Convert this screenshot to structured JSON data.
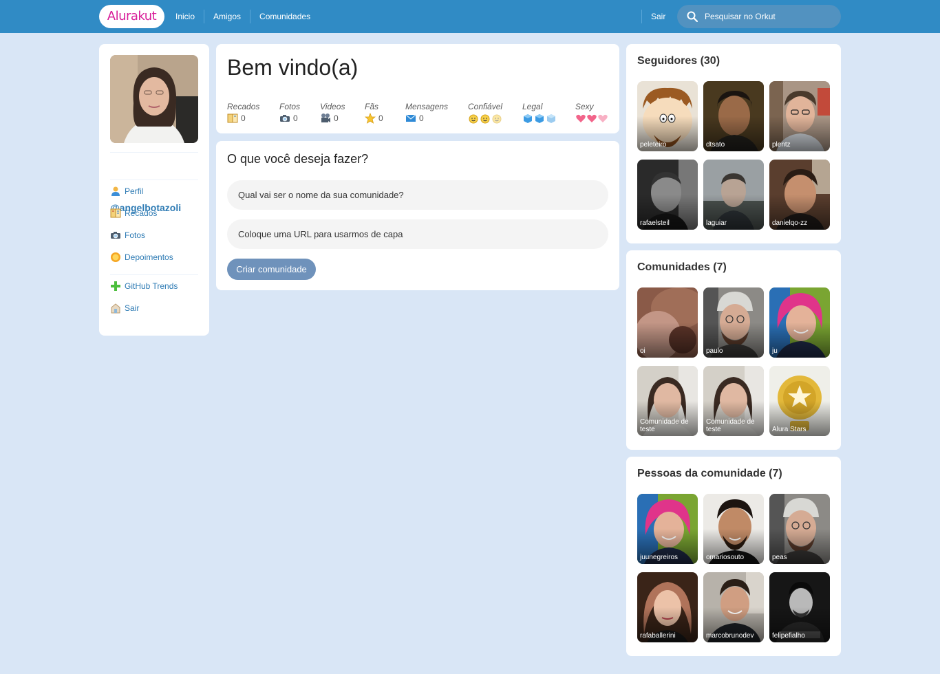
{
  "header": {
    "logo": "Alurakut",
    "nav": [
      "Inicio",
      "Amigos",
      "Comunidades"
    ],
    "logout": "Sair",
    "search_placeholder": "Pesquisar no Orkut"
  },
  "profile": {
    "username": "@angelbotazoli",
    "menu": [
      {
        "label": "Perfil",
        "icon": "user-icon"
      },
      {
        "label": "Recados",
        "icon": "book-icon"
      },
      {
        "label": "Fotos",
        "icon": "camera-icon"
      },
      {
        "label": "Depoimentos",
        "icon": "sun-icon"
      },
      {
        "label": "GitHub Trends",
        "icon": "plus-icon"
      },
      {
        "label": "Sair",
        "icon": "logout-icon"
      }
    ]
  },
  "welcome": {
    "title": "Bem vindo(a)",
    "stats": [
      {
        "label": "Recados",
        "value": "0",
        "icon": "book-icon"
      },
      {
        "label": "Fotos",
        "value": "0",
        "icon": "camera-icon"
      },
      {
        "label": "Videos",
        "value": "0",
        "icon": "video-camera-icon"
      },
      {
        "label": "Fãs",
        "value": "0",
        "icon": "star-icon"
      },
      {
        "label": "Mensagens",
        "value": "0",
        "icon": "envelope-icon"
      },
      {
        "label": "Confiável",
        "icon": "smiley-icon",
        "count": 3
      },
      {
        "label": "Legal",
        "icon": "ice-cube-icon",
        "count": 3
      },
      {
        "label": "Sexy",
        "icon": "heart-icon",
        "count": 3
      }
    ]
  },
  "form": {
    "title": "O que você deseja fazer?",
    "name_placeholder": "Qual vai ser o nome da sua comunidade?",
    "url_placeholder": "Coloque uma URL para usarmos de capa",
    "submit": "Criar comunidade"
  },
  "followers": {
    "title": "Seguidores (30)",
    "items": [
      "peleteiro",
      "dtsato",
      "plentz",
      "rafaelsteil",
      "laguiar",
      "danielqo-zz"
    ]
  },
  "communities": {
    "title": "Comunidades (7)",
    "items": [
      "oi",
      "paulo",
      "ju",
      "Comunidade de teste",
      "Comunidade de teste",
      "Alura Stars"
    ]
  },
  "community_people": {
    "title": "Pessoas da comunidade (7)",
    "items": [
      "juunegreiros",
      "omariosouto",
      "peas",
      "rafaballerini",
      "marcobrunodev",
      "felipefialho"
    ]
  },
  "colors": {
    "header": "#308bc5",
    "background": "#d9e6f6",
    "link": "#2e7bb4",
    "button": "#6f92bb",
    "logo_text": "#d81d99"
  }
}
